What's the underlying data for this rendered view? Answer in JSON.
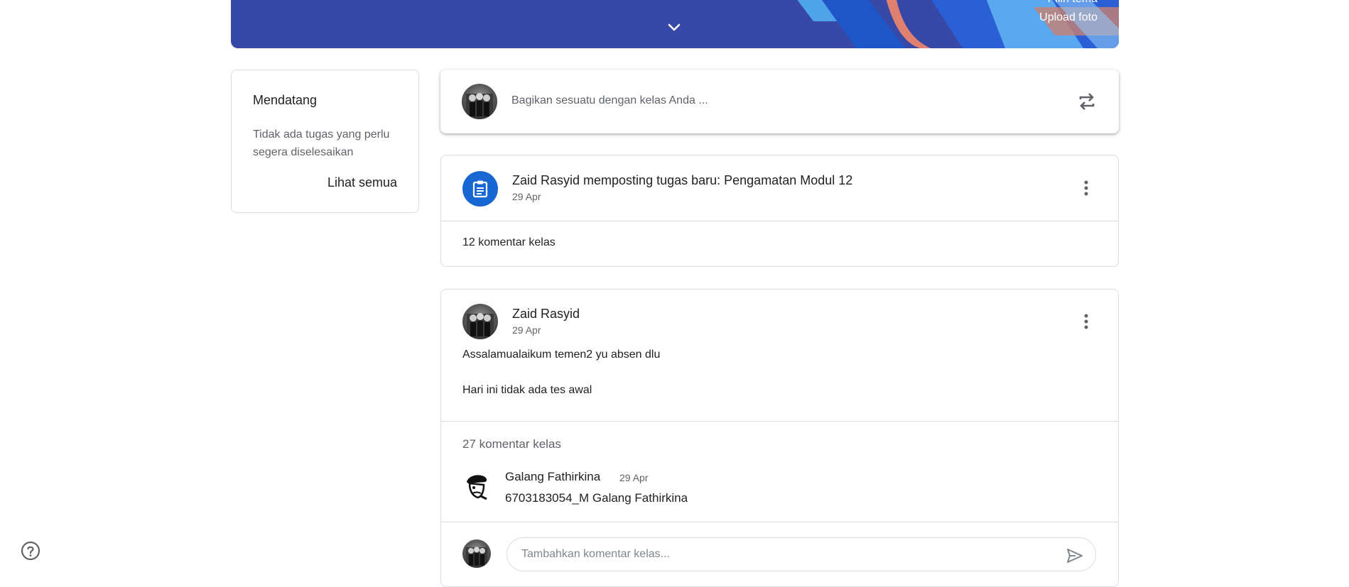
{
  "banner": {
    "choose_theme": "Pilih tema",
    "upload_photo": "Upload foto",
    "expand_icon": "chevron-down-icon",
    "color": "#3848a6"
  },
  "upcoming": {
    "title": "Mendatang",
    "empty_text": "Tidak ada tugas yang perlu segera diselesaikan",
    "view_all": "Lihat semua"
  },
  "share": {
    "placeholder": "Bagikan sesuatu dengan kelas Anda ...",
    "repost_icon": "repost-icon"
  },
  "assignment_post": {
    "title": "Zaid Rasyid memposting tugas baru: Pengamatan Modul 12",
    "date": "29 Apr",
    "comments": "12 komentar kelas",
    "icon": "assignment-icon",
    "accent": "#1967d2"
  },
  "announcement": {
    "author": "Zaid Rasyid",
    "date": "29 Apr",
    "body_line1": "Assalamualaikum temen2 yu absen dlu",
    "body_line2": "Hari ini tidak ada tes awal",
    "comment_count": "27 komentar kelas",
    "latest_comment": {
      "author": "Galang Fathirkina",
      "date": "29 Apr",
      "text": "6703183054_M Galang Fathirkina"
    },
    "comment_placeholder": "Tambahkan komentar kelas..."
  },
  "help_icon": "help-icon"
}
